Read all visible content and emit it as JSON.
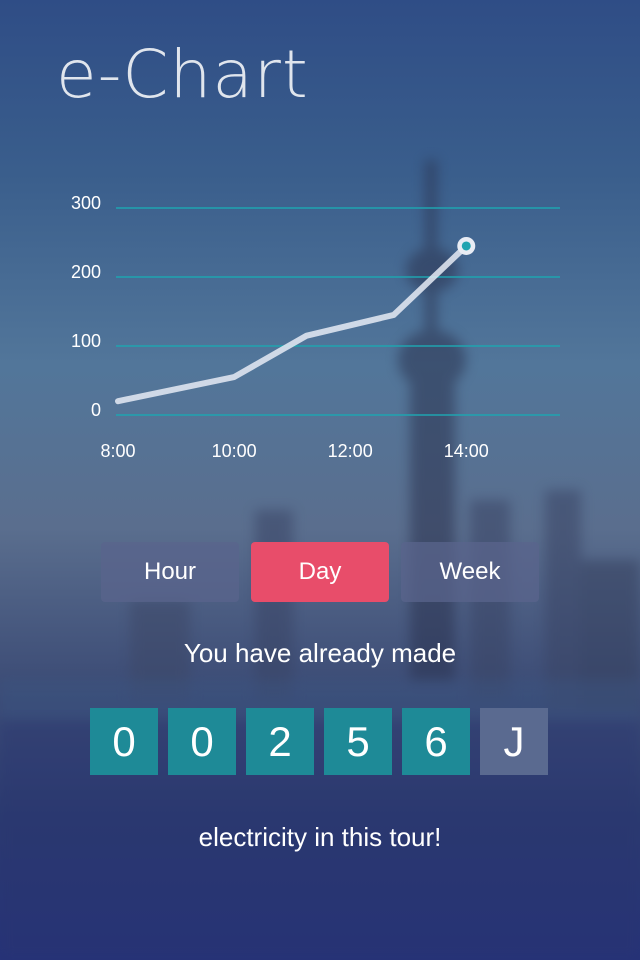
{
  "app": {
    "title": "e-Chart"
  },
  "colors": {
    "accent": "#e84d6a",
    "digit_bg": "#1e8a97",
    "grid": "#1fa4b0",
    "unit_bg": "#5a6a90"
  },
  "chart_data": {
    "type": "line",
    "title": "",
    "xlabel": "",
    "ylabel": "",
    "ylim": [
      0,
      300
    ],
    "yticks": [
      "0",
      "100",
      "200",
      "300"
    ],
    "xtick_labels": [
      "8:00",
      "10:00",
      "12:00",
      "14:00"
    ],
    "series": [
      {
        "x": [
          "8:00",
          "10:00",
          "11:15",
          "12:45",
          "14:00"
        ],
        "values": [
          20,
          55,
          115,
          145,
          245
        ]
      }
    ],
    "grid": true,
    "highlight_last_point": true
  },
  "tabs": [
    {
      "label": "Hour",
      "active": false
    },
    {
      "label": "Day",
      "active": true
    },
    {
      "label": "Week",
      "active": false
    }
  ],
  "message": {
    "line1": "You have already made",
    "digits": [
      "0",
      "0",
      "2",
      "5",
      "6"
    ],
    "unit": "J",
    "line2": "electricity in this tour!"
  }
}
